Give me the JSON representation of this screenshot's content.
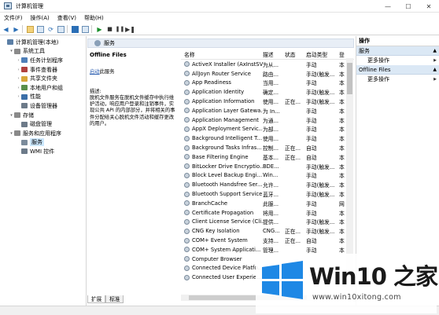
{
  "window": {
    "title": "计算机管理",
    "controls": [
      "—",
      "☐",
      "✕"
    ]
  },
  "menu": [
    "文件(F)",
    "操作(A)",
    "查看(V)",
    "帮助(H)"
  ],
  "tree": [
    {
      "label": "计算机管理(本地)",
      "level": 0,
      "arrow": "",
      "color": "#5b7fa6"
    },
    {
      "label": "系统工具",
      "level": 1,
      "arrow": "▾",
      "color": "#8a8a8a"
    },
    {
      "label": "任务计划程序",
      "level": 2,
      "arrow": "›",
      "color": "#4f7fb8"
    },
    {
      "label": "事件查看器",
      "level": 2,
      "arrow": "›",
      "color": "#b0413e"
    },
    {
      "label": "共享文件夹",
      "level": 2,
      "arrow": "›",
      "color": "#d8a73a"
    },
    {
      "label": "本地用户和组",
      "level": 2,
      "arrow": "›",
      "color": "#5a8f4a"
    },
    {
      "label": "性能",
      "level": 2,
      "arrow": "›",
      "color": "#3b6fa8"
    },
    {
      "label": "设备管理器",
      "level": 2,
      "arrow": "",
      "color": "#6c7a89"
    },
    {
      "label": "存储",
      "level": 1,
      "arrow": "▾",
      "color": "#8a8a8a"
    },
    {
      "label": "磁盘管理",
      "level": 2,
      "arrow": "",
      "color": "#6c7a89"
    },
    {
      "label": "服务和应用程序",
      "level": 1,
      "arrow": "▾",
      "color": "#8a8a8a"
    },
    {
      "label": "服务",
      "level": 2,
      "arrow": "",
      "color": "#7b8b9b",
      "selected": true
    },
    {
      "label": "WMI 控件",
      "level": 2,
      "arrow": "",
      "color": "#6c7a89"
    }
  ],
  "center": {
    "header": "服务",
    "desc_title": "Offline Files",
    "start_link": "启动",
    "start_suffix": "此服务",
    "desc_label": "描述:",
    "desc_text": "脱机文件服务在脱机文件缓存中执行维护活动，响应用户登录和注销事件，实现公共 API 的内部部分，并将相关的事件分配给关心脱机文件活动和缓存更改的用户。",
    "tabs": [
      "扩展",
      "标准"
    ]
  },
  "columns": [
    "名称",
    "描述",
    "状态",
    "启动类型",
    "登"
  ],
  "services": [
    {
      "name": "ActiveX Installer (AxInstSV)",
      "desc": "为从...",
      "status": "",
      "start": "手动",
      "log": "本"
    },
    {
      "name": "AllJoyn Router Service",
      "desc": "路由...",
      "status": "",
      "start": "手动(触发...",
      "log": "本"
    },
    {
      "name": "App Readiness",
      "desc": "当用...",
      "status": "",
      "start": "手动",
      "log": "本"
    },
    {
      "name": "Application Identity",
      "desc": "确定...",
      "status": "",
      "start": "手动(触发...",
      "log": "本"
    },
    {
      "name": "Application Information",
      "desc": "使用...",
      "status": "正在...",
      "start": "手动(触发...",
      "log": "本"
    },
    {
      "name": "Application Layer Gatewa...",
      "desc": "为 In...",
      "status": "",
      "start": "手动",
      "log": "本"
    },
    {
      "name": "Application Management",
      "desc": "为通...",
      "status": "",
      "start": "手动",
      "log": "本"
    },
    {
      "name": "AppX Deployment Servic...",
      "desc": "为部...",
      "status": "",
      "start": "手动",
      "log": "本"
    },
    {
      "name": "Background Intelligent T...",
      "desc": "使用...",
      "status": "",
      "start": "手动",
      "log": "本"
    },
    {
      "name": "Background Tasks Infras...",
      "desc": "控制...",
      "status": "正在...",
      "start": "自动",
      "log": "本"
    },
    {
      "name": "Base Filtering Engine",
      "desc": "基本...",
      "status": "正在...",
      "start": "自动",
      "log": "本"
    },
    {
      "name": "BitLocker Drive Encryptio...",
      "desc": "BDE...",
      "status": "",
      "start": "手动(触发...",
      "log": "本"
    },
    {
      "name": "Block Level Backup Engi...",
      "desc": "Win...",
      "status": "",
      "start": "手动",
      "log": "本"
    },
    {
      "name": "Bluetooth Handsfree Ser...",
      "desc": "允许...",
      "status": "",
      "start": "手动(触发...",
      "log": "本"
    },
    {
      "name": "Bluetooth Support Service",
      "desc": "蓝牙...",
      "status": "",
      "start": "手动(触发...",
      "log": "本"
    },
    {
      "name": "BranchCache",
      "desc": "此服...",
      "status": "",
      "start": "手动",
      "log": "网"
    },
    {
      "name": "Certificate Propagation",
      "desc": "将用...",
      "status": "",
      "start": "手动",
      "log": "本"
    },
    {
      "name": "Client License Service (Cli...",
      "desc": "提供...",
      "status": "",
      "start": "手动(触发...",
      "log": "本"
    },
    {
      "name": "CNG Key Isolation",
      "desc": "CNG...",
      "status": "正在...",
      "start": "手动(触发...",
      "log": "本"
    },
    {
      "name": "COM+ Event System",
      "desc": "支持...",
      "status": "正在...",
      "start": "自动",
      "log": "本"
    },
    {
      "name": "COM+ System Applicati...",
      "desc": "管理...",
      "status": "",
      "start": "手动",
      "log": "本"
    },
    {
      "name": "Computer Browser",
      "desc": "",
      "status": "",
      "start": "",
      "log": ""
    },
    {
      "name": "Connected Device Platfo...",
      "desc": "",
      "status": "",
      "start": "",
      "log": ""
    },
    {
      "name": "Connected User Experie...",
      "desc": "",
      "status": "",
      "start": "",
      "log": ""
    }
  ],
  "actions": {
    "title": "操作",
    "sections": [
      {
        "label": "服务",
        "items": [
          "更多操作"
        ]
      },
      {
        "label": "Offline Files",
        "items": [
          "更多操作"
        ]
      }
    ]
  },
  "watermark": {
    "brand": "Win10 之家",
    "url": "www.win10xitong.com"
  },
  "colors": {
    "accent": "#2a5db0",
    "selected": "#cce8ff",
    "section": "#dbe8f5",
    "logo_blue": "#1e88e5"
  }
}
